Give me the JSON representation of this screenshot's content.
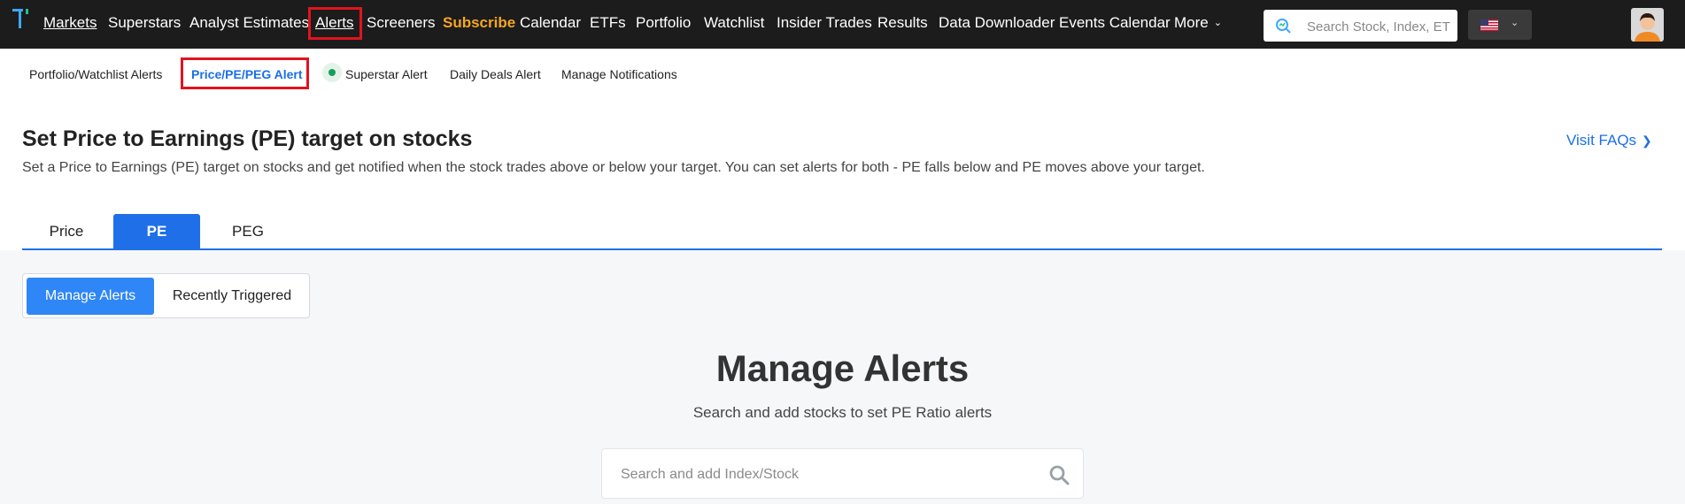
{
  "topnav": {
    "items": [
      {
        "label": "Markets",
        "underlined": true
      },
      {
        "label": "Superstars"
      },
      {
        "label": "Analyst Estimates"
      },
      {
        "label": "Alerts",
        "underlined": true
      },
      {
        "label": "Screeners"
      },
      {
        "label": "Subscribe",
        "highlight": true
      },
      {
        "label": "Calendar"
      },
      {
        "label": "ETFs"
      },
      {
        "label": "Portfolio"
      },
      {
        "label": "Watchlist"
      },
      {
        "label": "Insider Trades"
      },
      {
        "label": "Results"
      },
      {
        "label": "Data Downloader"
      },
      {
        "label": "Events Calendar"
      },
      {
        "label": "More"
      }
    ],
    "search_placeholder": "Search Stock, Index, ETF",
    "subscribe_color": "#f5a623"
  },
  "subnav": {
    "items": [
      {
        "label": "Portfolio/Watchlist Alerts"
      },
      {
        "label": "Price/PE/PEG Alert",
        "active": true
      },
      {
        "label": "Superstar Alert"
      },
      {
        "label": "Daily Deals Alert"
      },
      {
        "label": "Manage Notifications"
      }
    ]
  },
  "heading": {
    "title": "Set Price to Earnings (PE) target on stocks",
    "description": "Set a Price to Earnings (PE) target on stocks and get notified when the stock trades above or below your target. You can set alerts for both - PE falls below and PE moves above your target.",
    "faq_link": "Visit FAQs"
  },
  "tabs": [
    {
      "label": "Price"
    },
    {
      "label": "PE",
      "active": true
    },
    {
      "label": "PEG"
    }
  ],
  "segment": {
    "manage": "Manage Alerts",
    "recent": "Recently Triggered"
  },
  "main": {
    "title": "Manage Alerts",
    "subtitle": "Search and add stocks to set PE Ratio alerts",
    "search_placeholder": "Search and add Index/Stock"
  },
  "colors": {
    "accent": "#1f6fe8",
    "nav_bg": "#1c1c1c",
    "highlight_box": "#e0141e"
  }
}
